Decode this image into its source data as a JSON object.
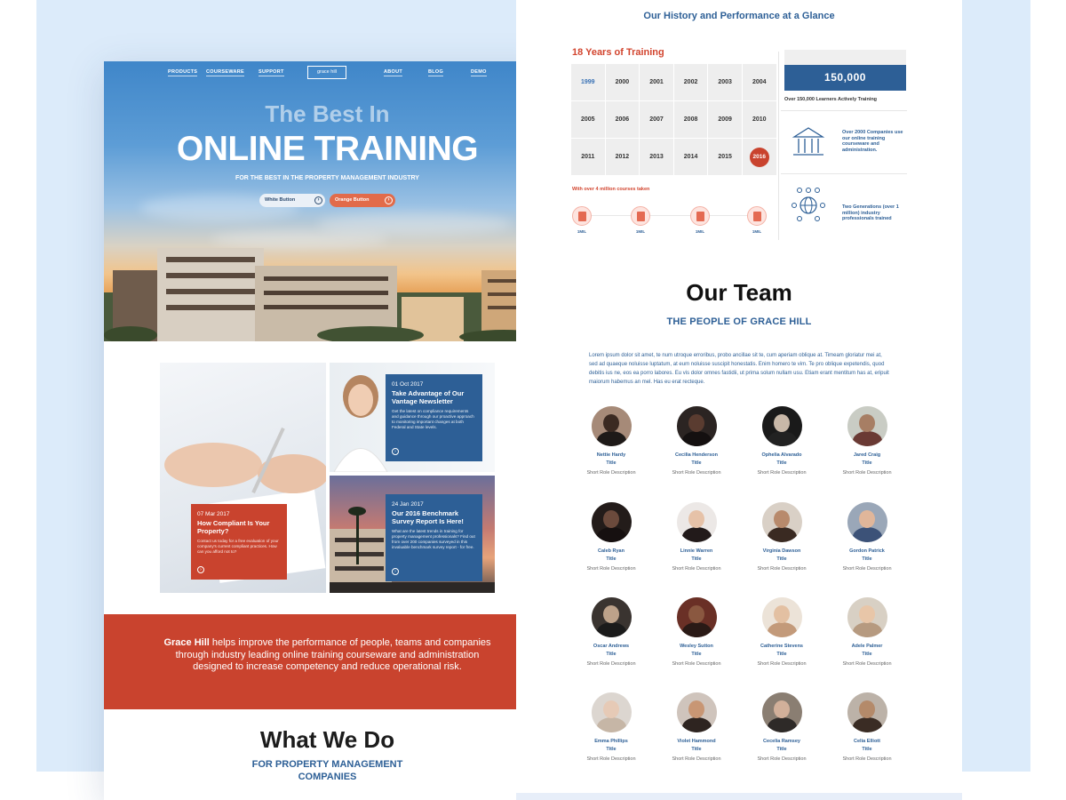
{
  "left": {
    "nav": {
      "items": [
        "PRODUCTS",
        "COURSEWARE",
        "SUPPORT",
        "ABOUT",
        "BLOG",
        "DEMO"
      ],
      "logo": "grace hill"
    },
    "hero": {
      "heading_small": "The Best In",
      "heading_big": "ONLINE TRAINING",
      "subheading": "FOR THE BEST IN THE PROPERTY MANAGEMENT INDUSTRY",
      "white_button": "White Button",
      "orange_button": "Orange Button"
    },
    "news": [
      {
        "date": "07 Mar 2017",
        "title": "How Compliant Is Your Property?",
        "desc": "Contact us today for a free evaluation of your company's current compliant practices. How can you afford not to?",
        "color": "#c9432e"
      },
      {
        "date": "01 Oct 2017",
        "title": "Take Advantage of Our Vantage Newsletter",
        "desc": "Get the latest on compliance requirements and guidance through our proactive approach to monitoring important changes at both Federal and State levels.",
        "color": "#2d5f96"
      },
      {
        "date": "24 Jan 2017",
        "title": "Our 2016 Benchmark Survey Report Is Here!",
        "desc": "What are the latest trends in training for property management professionals? Find out from over 200 companies surveyed in this invaluable benchmark survey report - for free.",
        "color": "#2d5f96"
      }
    ],
    "about": {
      "brand": "Grace Hill",
      "text": " helps improve the performance of people, teams and companies through industry leading online training courseware and administration designed to increase competency and reduce operational risk."
    },
    "what_we_do": {
      "title": "What We Do",
      "subtitle": "FOR PROPERTY MANAGEMENT COMPANIES"
    }
  },
  "right": {
    "history_title": "Our History and Performance at a Glance",
    "years_title": "18 Years of Training",
    "years": [
      "1999",
      "2000",
      "2001",
      "2002",
      "2003",
      "2004",
      "2005",
      "2006",
      "2007",
      "2008",
      "2009",
      "2010",
      "2011",
      "2012",
      "2013",
      "2014",
      "2015",
      "2016"
    ],
    "current_year": "2016",
    "courses_note": "With over 4 million courses taken",
    "course_labels": [
      "1MIL",
      "1MIL",
      "1MIL",
      "1MIL"
    ],
    "stat_value": "150,000",
    "stat_caption": "Over 150,000 Learners Actively Training",
    "stat_companies": "Over 2000 Companies use our online training courseware and administration.",
    "stat_generations": "Two Generations (over 1 million) industry professionals trained",
    "team_title": "Our Team",
    "team_subtitle": "THE PEOPLE OF GRACE HILL",
    "team_intro": "Lorem ipsum dolor sit amet, te num utroque erroribus, probo ancillae sit te, cum aperiam oblique at. Timeam gloriatur mei at, sed ad quaeque noluisse luptatum, at eum noluisse suscipit honestatis. Enim homero te vim. Te pro oblique expetendis, quod debitis ius ne, eos ea porro labores. Eu vis dolor omnes fastidii, ut prima solum nullam usu. Etiam erant mentitum has at, eripuit maiorum habemus an mel. Has eu erat recteque.",
    "member_title": "Title",
    "member_desc": "Short Role Description",
    "members": [
      {
        "name": "Nettie Hardy",
        "bg": "#a68a78",
        "skin": "#3b2a22",
        "cloth": "#1e1a18"
      },
      {
        "name": "Cecilia Henderson",
        "bg": "#2b2422",
        "skin": "#5a3c30",
        "cloth": "#141010"
      },
      {
        "name": "Ophelia Alvarado",
        "bg": "#1a1a1a",
        "skin": "#c8b8a8",
        "cloth": "#222"
      },
      {
        "name": "Jared Craig",
        "bg": "#c9ccc4",
        "skin": "#a77e64",
        "cloth": "#6a3a34"
      },
      {
        "name": "Caleb Ryan",
        "bg": "#231c1a",
        "skin": "#6b4a3c",
        "cloth": "#161010"
      },
      {
        "name": "Linnie Warren",
        "bg": "#ece8e6",
        "skin": "#e6c2a8",
        "cloth": "#221a1a"
      },
      {
        "name": "Virginia Dawson",
        "bg": "#d9d0c6",
        "skin": "#b88a6c",
        "cloth": "#3a2a22"
      },
      {
        "name": "Gordon Patrick",
        "bg": "#9aa7b8",
        "skin": "#e0b69a",
        "cloth": "#3c5278"
      },
      {
        "name": "Oscar Andrews",
        "bg": "#3a3430",
        "skin": "#bda28a",
        "cloth": "#1b1b1b"
      },
      {
        "name": "Wesley Sutton",
        "bg": "#6a3026",
        "skin": "#8a5840",
        "cloth": "#2a1a16"
      },
      {
        "name": "Catherine Stevens",
        "bg": "#ece3d8",
        "skin": "#e3c0a2",
        "cloth": "#c39a7a"
      },
      {
        "name": "Adele Palmer",
        "bg": "#d8d0c4",
        "skin": "#e8c6a8",
        "cloth": "#b69a80"
      },
      {
        "name": "Emma Phillips",
        "bg": "#dcd6d0",
        "skin": "#e6cab6",
        "cloth": "#c6b6a6"
      },
      {
        "name": "Violet Hammond",
        "bg": "#cfc4bc",
        "skin": "#c89674",
        "cloth": "#2e2420"
      },
      {
        "name": "Cecelia Ramsey",
        "bg": "#8a7e72",
        "skin": "#d2b09a",
        "cloth": "#2e2a28"
      },
      {
        "name": "Celia Elliott",
        "bg": "#bcb2a8",
        "skin": "#b48a6a",
        "cloth": "#3a2c24"
      }
    ]
  },
  "colors": {
    "brand_blue": "#2d5f96",
    "brand_red": "#c9432e",
    "page_background": "#dcebfa"
  }
}
